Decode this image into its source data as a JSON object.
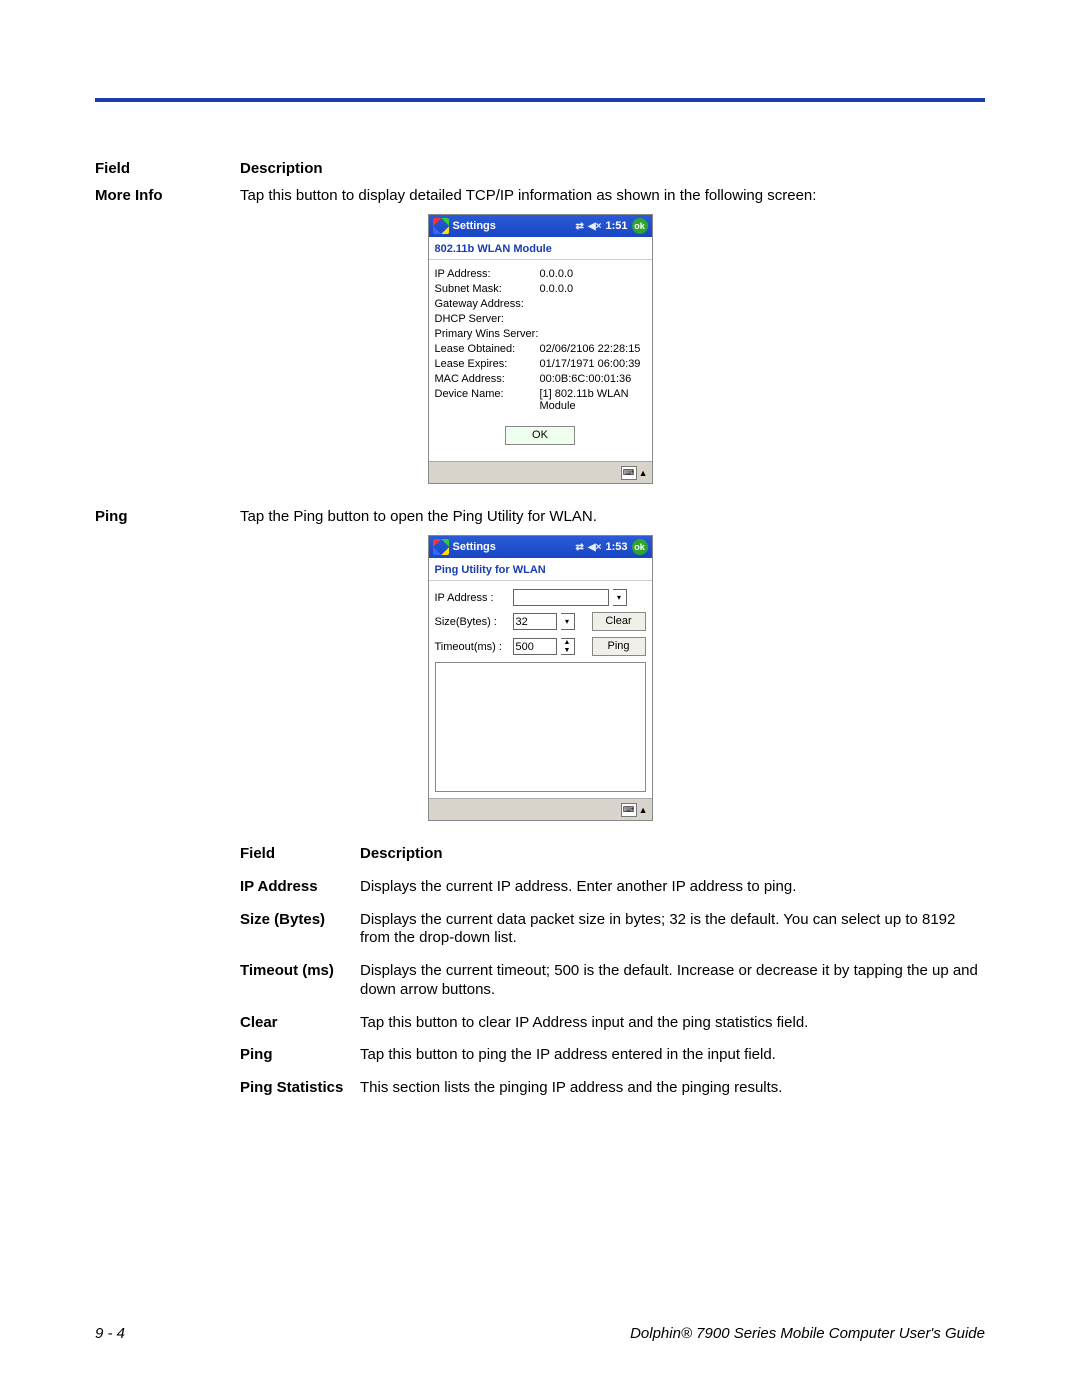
{
  "header": {
    "field_label": "Field",
    "desc_label": "Description"
  },
  "moreinfo": {
    "field": "More Info",
    "desc": "Tap this button to display detailed TCP/IP information as shown in the following screen:"
  },
  "wlan_win": {
    "title": "Settings",
    "time": "1:51",
    "ok": "ok",
    "subtitle": "802.11b WLAN Module",
    "rows": {
      "ip_k": "IP Address:",
      "ip_v": "0.0.0.0",
      "sm_k": "Subnet Mask:",
      "sm_v": "0.0.0.0",
      "gw_k": "Gateway Address:",
      "gw_v": "",
      "dh_k": "DHCP Server:",
      "dh_v": "",
      "pw_k": "Primary Wins Server:",
      "pw_v": "",
      "lo_k": "Lease Obtained:",
      "lo_v": "02/06/2106 22:28:15",
      "le_k": "Lease Expires:",
      "le_v": "01/17/1971 06:00:39",
      "mac_k": "MAC Address:",
      "mac_v": "00:0B:6C:00:01:36",
      "dn_k": "Device Name:",
      "dn_v": "[1] 802.11b WLAN Module"
    },
    "ok_btn": "OK"
  },
  "ping": {
    "field": "Ping",
    "desc": "Tap the Ping button to open the Ping Utility for WLAN."
  },
  "ping_win": {
    "title": "Settings",
    "time": "1:53",
    "ok": "ok",
    "subtitle": "Ping Utility for WLAN",
    "ip_lbl": "IP Address   :",
    "ip_val": "",
    "size_lbl": "Size(Bytes)  :",
    "size_val": "32",
    "timeout_lbl": "Timeout(ms) :",
    "timeout_val": "500",
    "clear_btn": "Clear",
    "ping_btn": "Ping"
  },
  "sub_header": {
    "field": "Field",
    "desc": "Description"
  },
  "sub": [
    {
      "f": "IP Address",
      "d": "Displays the current IP address. Enter another IP address to ping."
    },
    {
      "f": "Size (Bytes)",
      "d": "Displays the current data packet size in bytes; 32 is the default. You can select up to 8192 from the drop-down list."
    },
    {
      "f": "Timeout (ms)",
      "d": "Displays the current timeout; 500 is the default. Increase or decrease it by tapping the up and down arrow buttons."
    },
    {
      "f": "Clear",
      "d": "Tap this button to clear IP Address input and the ping statistics field."
    },
    {
      "f": "Ping",
      "d": "Tap this button to ping the IP address entered in the input field."
    },
    {
      "f": "Ping Statistics",
      "d": "This section lists the pinging IP address and the pinging results."
    }
  ],
  "footer": {
    "page": "9 - 4",
    "title": "Dolphin® 7900 Series Mobile Computer User's Guide"
  }
}
